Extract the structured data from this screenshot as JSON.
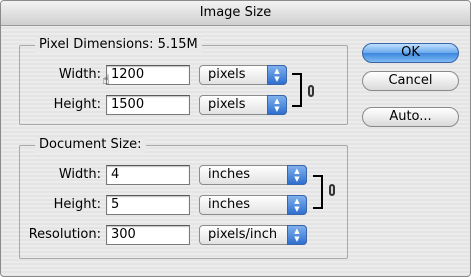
{
  "window": {
    "title": "Image Size"
  },
  "pixel_dimensions": {
    "title": "Pixel Dimensions:",
    "size": "5.15M",
    "width": {
      "label": "Width:",
      "value": "1200",
      "unit": "pixels"
    },
    "height": {
      "label": "Height:",
      "value": "1500",
      "unit": "pixels"
    }
  },
  "document_size": {
    "title": "Document Size:",
    "width": {
      "label": "Width:",
      "value": "4",
      "unit": "inches"
    },
    "height": {
      "label": "Height:",
      "value": "5",
      "unit": "inches"
    },
    "resolution": {
      "label": "Resolution:",
      "value": "300",
      "unit": "pixels/inch"
    }
  },
  "buttons": {
    "ok": "OK",
    "cancel": "Cancel",
    "auto": "Auto..."
  },
  "icons": {
    "link": "link-icon",
    "popup": "popup-arrows-icon",
    "cursor": "hand-cursor-icon"
  }
}
